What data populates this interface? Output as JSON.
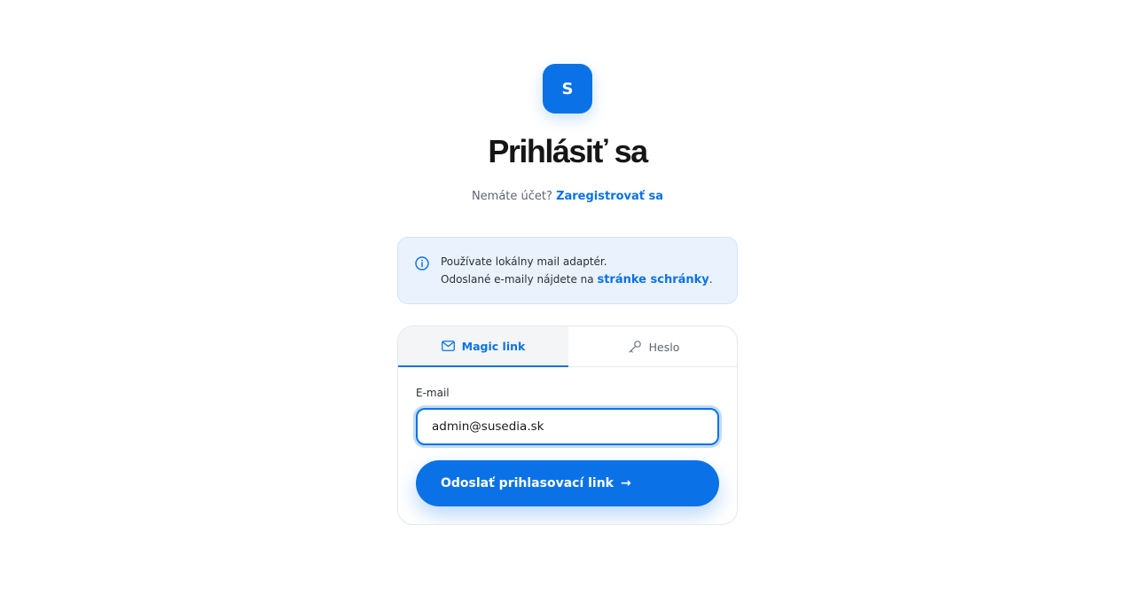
{
  "brand": {
    "logo_letter": "S",
    "accent": "#0a72e6"
  },
  "header": {
    "title": "Prihlásiť sa",
    "no_account_text": "Nemáte účet?",
    "register_link": "Zaregistrovať sa"
  },
  "info": {
    "icon": "info-circle-icon",
    "line1": "Používate lokálny mail adaptér.",
    "line2_prefix": "Odoslané e-maily nájdete na",
    "inbox_link": "stránke schránky",
    "line2_suffix": "."
  },
  "tabs": [
    {
      "label": "Magic link",
      "icon": "mail-icon",
      "active": true
    },
    {
      "label": "Heslo",
      "icon": "key-icon",
      "active": false
    }
  ],
  "form": {
    "email_label": "E-mail",
    "email_value": "admin@susedia.sk",
    "submit_label": "Odoslať prihlasovací link",
    "submit_arrow": "→"
  }
}
